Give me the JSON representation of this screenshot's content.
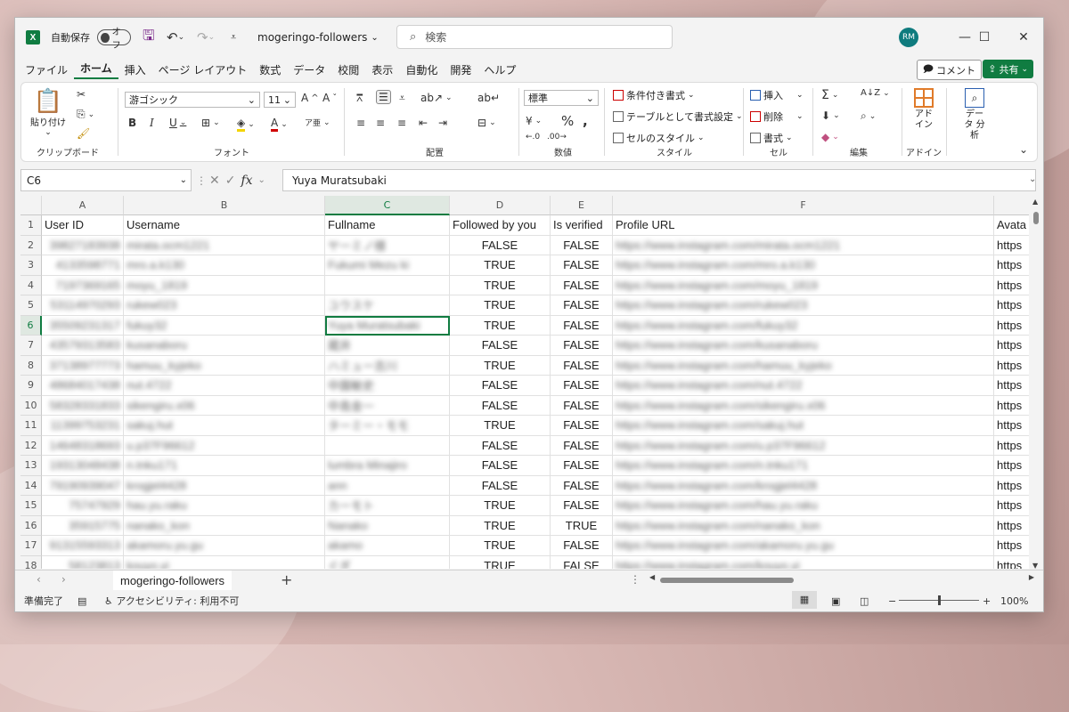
{
  "titlebar": {
    "autosave_label": "自動保存",
    "autosave_state": "オフ",
    "filename": "mogeringo-followers",
    "search_placeholder": "検索",
    "user_initials": "RM"
  },
  "menu": {
    "tabs": [
      "ファイル",
      "ホーム",
      "挿入",
      "ページ レイアウト",
      "数式",
      "データ",
      "校閲",
      "表示",
      "自動化",
      "開発",
      "ヘルプ"
    ],
    "active_tab": "ホーム",
    "comment_label": "コメント",
    "share_label": "共有"
  },
  "ribbon": {
    "clipboard": {
      "paste_label": "貼り付け",
      "group_label": "クリップボード"
    },
    "font": {
      "font_name": "游ゴシック",
      "font_size": "11",
      "group_label": "フォント"
    },
    "alignment": {
      "group_label": "配置"
    },
    "number": {
      "format": "標準",
      "group_label": "数値"
    },
    "styles": {
      "conditional_format": "条件付き書式",
      "format_as_table": "テーブルとして書式設定",
      "cell_styles": "セルのスタイル",
      "group_label": "スタイル"
    },
    "cells": {
      "insert": "挿入",
      "delete": "削除",
      "format": "書式",
      "group_label": "セル"
    },
    "editing": {
      "group_label": "編集"
    },
    "addins": {
      "label": "アド イン",
      "group_label": "アドイン"
    },
    "analysis": {
      "label": "データ 分析"
    }
  },
  "formula_bar": {
    "cell_ref": "C6",
    "formula": "Yuya Muratsubaki"
  },
  "sheet": {
    "column_letters": [
      "A",
      "B",
      "C",
      "D",
      "E",
      "F",
      ""
    ],
    "headers": [
      "User ID",
      "Username",
      "Fullname",
      "Followed by you",
      "Is verified",
      "Profile URL",
      "Avata"
    ],
    "row_numbers": [
      "1",
      "2",
      "3",
      "4",
      "5",
      "6",
      "7",
      "8",
      "9",
      "10",
      "11",
      "12",
      "13",
      "14",
      "15",
      "16",
      "17",
      "18"
    ],
    "rows": [
      [
        "39827183938",
        "mirata.ocm1221",
        "ヤーミノ様",
        "FALSE",
        "FALSE",
        "https://www.instagram.com/mirata.ocm1221",
        "https"
      ],
      [
        "4133598771",
        "mro.a.k130",
        "Fukumi Mezu ki",
        "TRUE",
        "FALSE",
        "https://www.instagram.com/mro.a.k130",
        "https"
      ],
      [
        "7197369165",
        "moyu_1819",
        "",
        "TRUE",
        "FALSE",
        "https://www.instagram.com/moyu_1819",
        "https"
      ],
      [
        "53114970293",
        "rukew023",
        "ユウスケ",
        "TRUE",
        "FALSE",
        "https://www.instagram.com/rukew023",
        "https"
      ],
      [
        "35509231317",
        "fukuy32",
        "Yuya Muratsubaki",
        "TRUE",
        "FALSE",
        "https://www.instagram.com/fukuy32",
        "https"
      ],
      [
        "43579313583",
        "kusanaboru",
        "蔵井",
        "FALSE",
        "FALSE",
        "https://www.instagram.com/kusanaboru",
        "https"
      ],
      [
        "37138977773",
        "hamuu_kyjeko",
        "ハミュー吉川",
        "TRUE",
        "FALSE",
        "https://www.instagram.com/hamuu_kyjeko",
        "https"
      ],
      [
        "48684017438",
        "nut.4722",
        "中園敏史",
        "FALSE",
        "FALSE",
        "https://www.instagram.com/nut.4722",
        "https"
      ],
      [
        "58328331833",
        "sikengiru.x06",
        "中島金一",
        "FALSE",
        "FALSE",
        "https://www.instagram.com/sikengiru.x06",
        "https"
      ],
      [
        "11399753231",
        "sakuj.hut",
        "ターミー・モモ",
        "TRUE",
        "FALSE",
        "https://www.instagram.com/sakuj.hut",
        "https"
      ],
      [
        "14648318693",
        "u.p37F96612",
        "",
        "FALSE",
        "FALSE",
        "https://www.instagram.com/u.p37F96612",
        "https"
      ],
      [
        "19313048438",
        "n.tnku171",
        "lumbra Minajiro",
        "FALSE",
        "FALSE",
        "https://www.instagram.com/n.tnku171",
        "https"
      ],
      [
        "79190939047",
        "krogjel4428",
        "ann",
        "FALSE",
        "FALSE",
        "https://www.instagram.com/krogjel4428",
        "https"
      ],
      [
        "75747929",
        "hau.yu.raku",
        "カーモト",
        "TRUE",
        "FALSE",
        "https://www.instagram.com/hau.yu.raku",
        "https"
      ],
      [
        "35915775",
        "nanako_kon",
        "Nanako",
        "TRUE",
        "TRUE",
        "https://www.instagram.com/nanako_kon",
        "https"
      ],
      [
        "91315593313",
        "akamoru.yu.gu",
        "akamo",
        "TRUE",
        "FALSE",
        "https://www.instagram.com/akamoru.yu.gu",
        "https"
      ],
      [
        "58123813",
        "kouyo.yi",
        "ぐぎ",
        "TRUE",
        "FALSE",
        "https://www.instagram.com/kouyo.yi",
        "https"
      ]
    ],
    "tab_name": "mogeringo-followers",
    "add_sheet": "+"
  },
  "status": {
    "ready": "準備完了",
    "accessibility": "アクセシビリティ: 利用不可",
    "zoom": "100%"
  },
  "colors": {
    "accent": "#107c41",
    "avatar": "#0f7b7e"
  }
}
